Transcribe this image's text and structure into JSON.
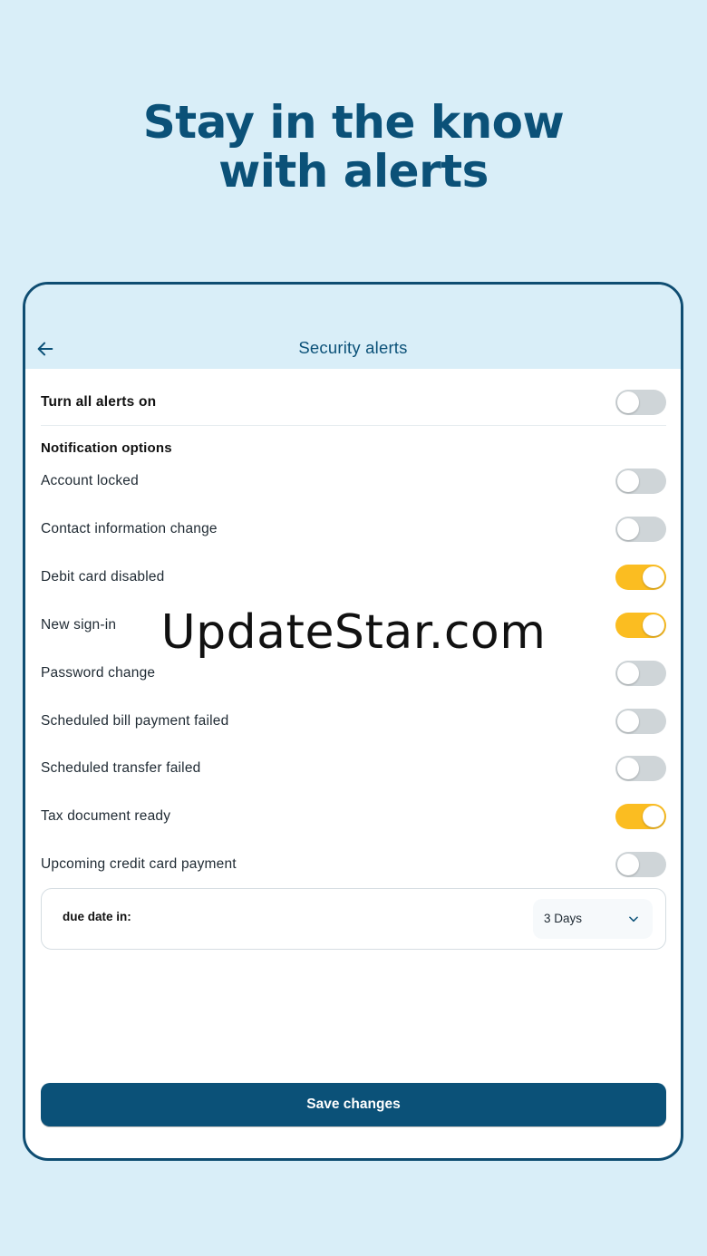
{
  "headline": {
    "line1": "Stay in the know",
    "line2": "with alerts"
  },
  "appbar": {
    "title": "Security alerts",
    "back_icon": "arrow-left-icon"
  },
  "master_toggle": {
    "label": "Turn all alerts on",
    "on": false
  },
  "section_title": "Notification options",
  "alerts": [
    {
      "label": "Account locked",
      "on": false
    },
    {
      "label": "Contact information change",
      "on": false
    },
    {
      "label": "Debit card disabled",
      "on": true
    },
    {
      "label": "New sign-in",
      "on": true
    },
    {
      "label": "Password change",
      "on": false
    },
    {
      "label": "Scheduled bill payment failed",
      "on": false
    },
    {
      "label": "Scheduled transfer failed",
      "on": false
    },
    {
      "label": "Tax document ready",
      "on": true
    },
    {
      "label": "Upcoming credit card payment",
      "on": false
    }
  ],
  "due_date": {
    "label": "due date in:",
    "selected": "3 Days",
    "icon": "chevron-down-icon"
  },
  "save_button": "Save changes",
  "watermark": "UpdateStar.com",
  "colors": {
    "background": "#d9eef8",
    "primary": "#0b5178",
    "toggle_on": "#fbbd21",
    "toggle_off": "#cfd5d8"
  }
}
